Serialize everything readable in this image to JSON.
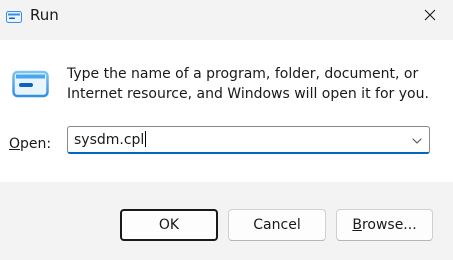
{
  "window": {
    "title": "Run",
    "app_icon": "run-icon",
    "close_icon": "close-icon"
  },
  "dialog": {
    "icon": "run-icon",
    "description": "Type the name of a program, folder, document, or Internet resource, and Windows will open it for you.",
    "open_label_mnemonic": "O",
    "open_label_rest": "pen:",
    "input_value": "sysdm.cpl",
    "dropdown_icon": "chevron-down-icon"
  },
  "buttons": {
    "ok_label": "OK",
    "cancel_label": "Cancel",
    "browse_mnemonic": "B",
    "browse_rest": "rowse..."
  },
  "colors": {
    "accent": "#0067c0",
    "background": "#f3f3f3",
    "content_background": "#ffffff"
  }
}
